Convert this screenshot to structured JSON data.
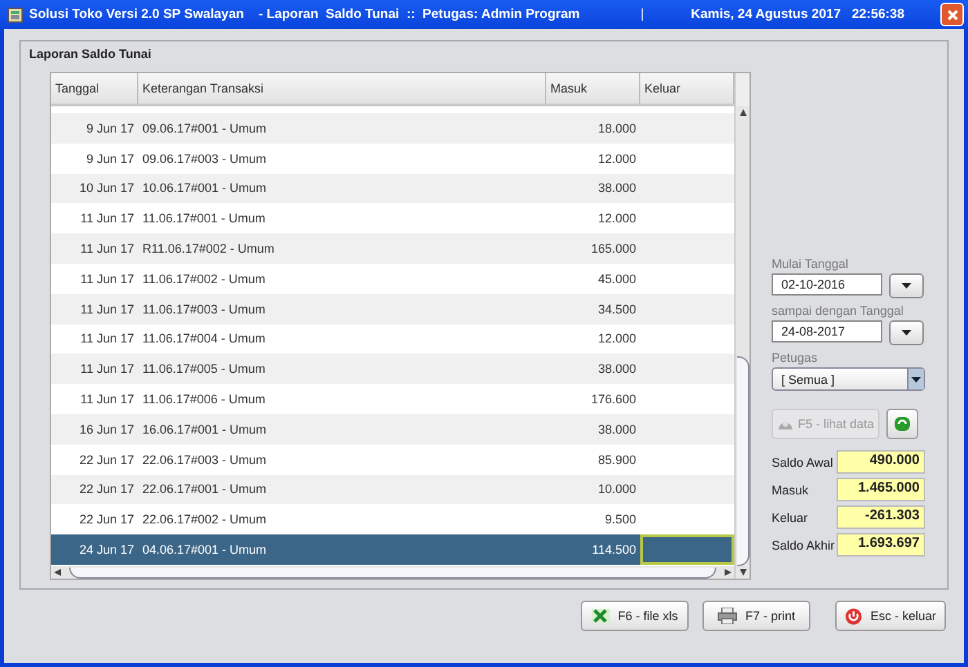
{
  "window": {
    "title": "Solusi Toko Versi 2.0 SP Swalayan    - Laporan  Saldo Tunai  ::  Petugas: Admin Program",
    "separator": "|",
    "datetime": "Kamis, 24 Agustus 2017   22:56:38"
  },
  "panel_title": "Laporan  Saldo Tunai",
  "table": {
    "columns": [
      "Tanggal",
      "Keterangan Transaksi",
      "Masuk",
      "Keluar"
    ],
    "rows": [
      {
        "cells": [
          "9 Jun 17",
          "09.06.17#001 - Umum",
          "18.000",
          ""
        ],
        "selected": false
      },
      {
        "cells": [
          "9 Jun 17",
          "09.06.17#003 - Umum",
          "12.000",
          ""
        ],
        "selected": false
      },
      {
        "cells": [
          "10 Jun 17",
          "10.06.17#001 - Umum",
          "38.000",
          ""
        ],
        "selected": false
      },
      {
        "cells": [
          "11 Jun 17",
          "11.06.17#001 - Umum",
          "12.000",
          ""
        ],
        "selected": false
      },
      {
        "cells": [
          "11 Jun 17",
          "R11.06.17#002 - Umum",
          "165.000",
          ""
        ],
        "selected": false
      },
      {
        "cells": [
          "11 Jun 17",
          "11.06.17#002 - Umum",
          "45.000",
          ""
        ],
        "selected": false
      },
      {
        "cells": [
          "11 Jun 17",
          "11.06.17#003 - Umum",
          "34.500",
          ""
        ],
        "selected": false
      },
      {
        "cells": [
          "11 Jun 17",
          "11.06.17#004 - Umum",
          "12.000",
          ""
        ],
        "selected": false
      },
      {
        "cells": [
          "11 Jun 17",
          "11.06.17#005 - Umum",
          "38.000",
          ""
        ],
        "selected": false
      },
      {
        "cells": [
          "11 Jun 17",
          "11.06.17#006 - Umum",
          "176.600",
          ""
        ],
        "selected": false
      },
      {
        "cells": [
          "16 Jun 17",
          "16.06.17#001 - Umum",
          "38.000",
          ""
        ],
        "selected": false
      },
      {
        "cells": [
          "22 Jun 17",
          "22.06.17#003 - Umum",
          "85.900",
          ""
        ],
        "selected": false
      },
      {
        "cells": [
          "22 Jun 17",
          "22.06.17#001 - Umum",
          "10.000",
          ""
        ],
        "selected": false
      },
      {
        "cells": [
          "22 Jun 17",
          "22.06.17#002 - Umum",
          "9.500",
          ""
        ],
        "selected": false
      },
      {
        "cells": [
          "24 Jun 17",
          "04.06.17#001 - Umum",
          "114.500",
          ""
        ],
        "selected": true
      }
    ]
  },
  "filters": {
    "start_label": "Mulai Tanggal",
    "start_date": "02-10-2016",
    "end_label": "sampai dengan Tanggal",
    "end_date": "24-08-2017",
    "officer_label": "Petugas",
    "officer": "[ Semua ]"
  },
  "view_button": {
    "label": "F5 - lihat data",
    "disabled": true
  },
  "summary": [
    {
      "label": "Saldo Awal",
      "value": "490.000"
    },
    {
      "label": "Masuk",
      "value": "1.465.000"
    },
    {
      "label": "Keluar",
      "value": "-261.303"
    },
    {
      "label": "Saldo Akhir",
      "value": "1.693.697"
    }
  ],
  "buttons": [
    {
      "kind": "excel",
      "label": "F6 - file xls"
    },
    {
      "kind": "print",
      "label": "F7 - print"
    },
    {
      "kind": "exit",
      "label": "Esc - keluar"
    }
  ]
}
